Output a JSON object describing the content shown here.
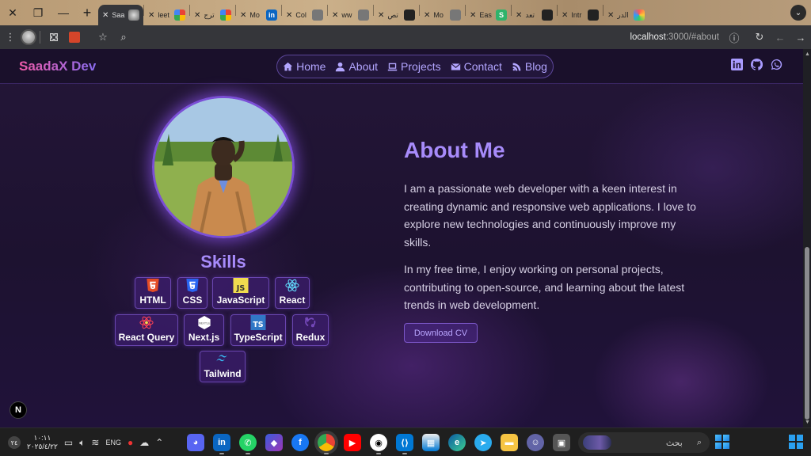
{
  "browser": {
    "tabs": [
      {
        "title": "Saa",
        "favicon": "avatar-icon",
        "active": true
      },
      {
        "title": "leet",
        "favicon": "google-icon"
      },
      {
        "title": "ترج",
        "favicon": "google-icon"
      },
      {
        "title": "Mo",
        "favicon": "linkedin-icon"
      },
      {
        "title": "Col",
        "favicon": "globe-icon"
      },
      {
        "title": "ww",
        "favicon": "globe-icon"
      },
      {
        "title": "تص",
        "favicon": "openai-icon"
      },
      {
        "title": "Mo",
        "favicon": "globe-icon"
      },
      {
        "title": "Eas",
        "favicon": "s-icon"
      },
      {
        "title": "تعد",
        "favicon": "openai-icon"
      },
      {
        "title": "Intr",
        "favicon": "openai-icon"
      },
      {
        "title": "الدر",
        "favicon": "colorful-icon"
      }
    ],
    "url_host": "localhost",
    "url_path": ":3000/#about"
  },
  "site": {
    "brand": "SaadaX Dev",
    "nav": {
      "home": "Home",
      "about": "About",
      "projects": "Projects",
      "contact": "Contact",
      "blog": "Blog"
    },
    "skills_title": "Skills",
    "skills": [
      "HTML",
      "CSS",
      "JavaScript",
      "React",
      "React Query",
      "Next.js",
      "TypeScript",
      "Redux",
      "Tailwind"
    ],
    "skill_icon_text": {
      "js": "JS",
      "ts": "TS",
      "next": "NEXT.js"
    },
    "about_title": "About Me",
    "about_p1": "I am a passionate web developer with a keen interest in creating dynamic and responsive web applications. I love to explore new technologies and continuously improve my skills.",
    "about_p2": "In my free time, I enjoy working on personal projects, contributing to open-source, and learning about the latest trends in web development.",
    "cv_button": "Download CV",
    "next_badge": "N"
  },
  "taskbar": {
    "time": "١٠:١١",
    "date": "٢٠٢٥/٤/٢٢",
    "notif_count": "٢٤",
    "lang": "ENG",
    "search_placeholder": "بحث"
  },
  "colors": {
    "accent": "#a78bfa",
    "brand_start": "#f05aa8",
    "brand_end": "#8a6cf0",
    "page_bg": "#1d1230"
  }
}
